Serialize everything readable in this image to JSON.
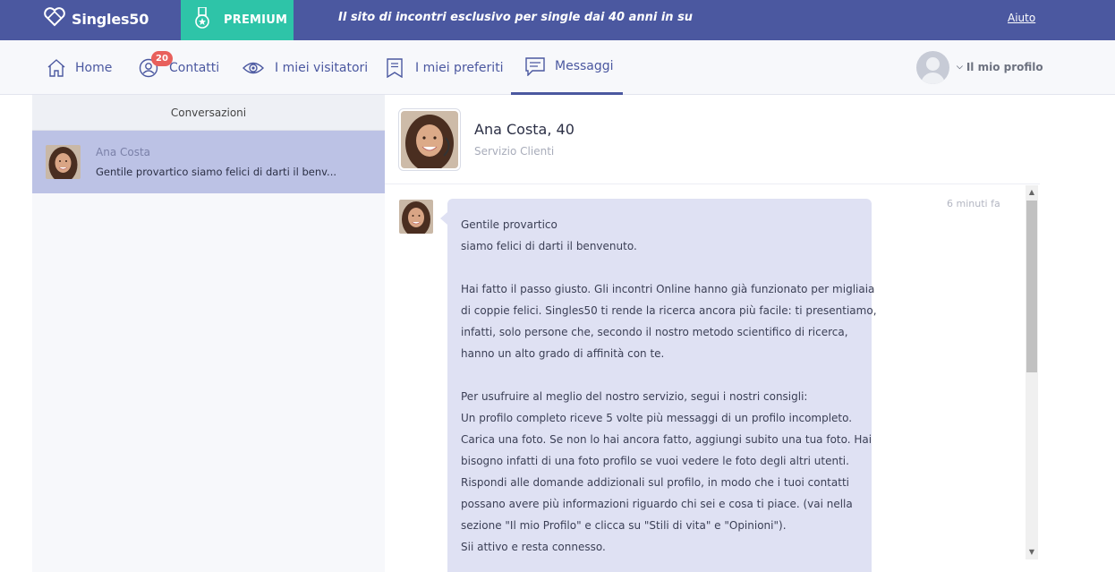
{
  "app": {
    "logo_text": "Singles50",
    "premium_label": "PREMIUM",
    "tagline": "Il sito di incontri esclusivo per single dai 40 anni in su",
    "help_label": "Aiuto"
  },
  "nav": {
    "items": [
      {
        "label": "Home",
        "icon": "home-icon"
      },
      {
        "label": "Contatti",
        "icon": "user-circle-icon",
        "badge": "20"
      },
      {
        "label": "I miei visitatori",
        "icon": "eye-icon"
      },
      {
        "label": "I miei preferiti",
        "icon": "bookmark-icon"
      },
      {
        "label": "Messaggi",
        "icon": "message-icon",
        "active": true
      }
    ],
    "profile_label": "Il mio profilo"
  },
  "conversations": {
    "header": "Conversazioni",
    "items": [
      {
        "name": "Ana Costa",
        "preview": "Gentile provartico siamo felici di darti il benv..."
      }
    ]
  },
  "chat": {
    "name": "Ana Costa, 40",
    "subtitle": "Servizio Clienti",
    "time": "6 minuti fa",
    "message_lines": [
      "Gentile provartico",
      "siamo felici di darti il benvenuto.",
      "",
      "Hai fatto il passo giusto. Gli incontri Online hanno già funzionato per migliaia",
      "di coppie felici. Singles50 ti rende la ricerca ancora più facile: ti presentiamo,",
      "infatti, solo persone che, secondo il nostro metodo scientifico di ricerca,",
      "hanno un alto grado di affinità con te.",
      "",
      "Per usufruire al meglio del nostro servizio, segui i nostri consigli:",
      "Un profilo completo riceve 5 volte più messaggi di un profilo incompleto.",
      "Carica una foto. Se non lo hai ancora fatto, aggiungi subito una tua foto. Hai",
      "bisogno infatti di una foto profilo se vuoi vedere le foto degli altri utenti.",
      "Rispondi alle domande addizionali sul profilo, in modo che i tuoi contatti",
      "possano avere più informazioni riguardo chi sei e cosa ti piace. (vai nella",
      "sezione \"Il mio Profilo\" e clicca su \"Stili di vita\" e \"Opinioni\").",
      "Sii attivo e resta connesso.",
      ""
    ]
  },
  "colors": {
    "brand": "#4b58a0",
    "premium": "#2ec4a8",
    "badge": "#e8605c",
    "selected_conversation": "#bcc2e5",
    "bubble": "#dfe1f3"
  }
}
